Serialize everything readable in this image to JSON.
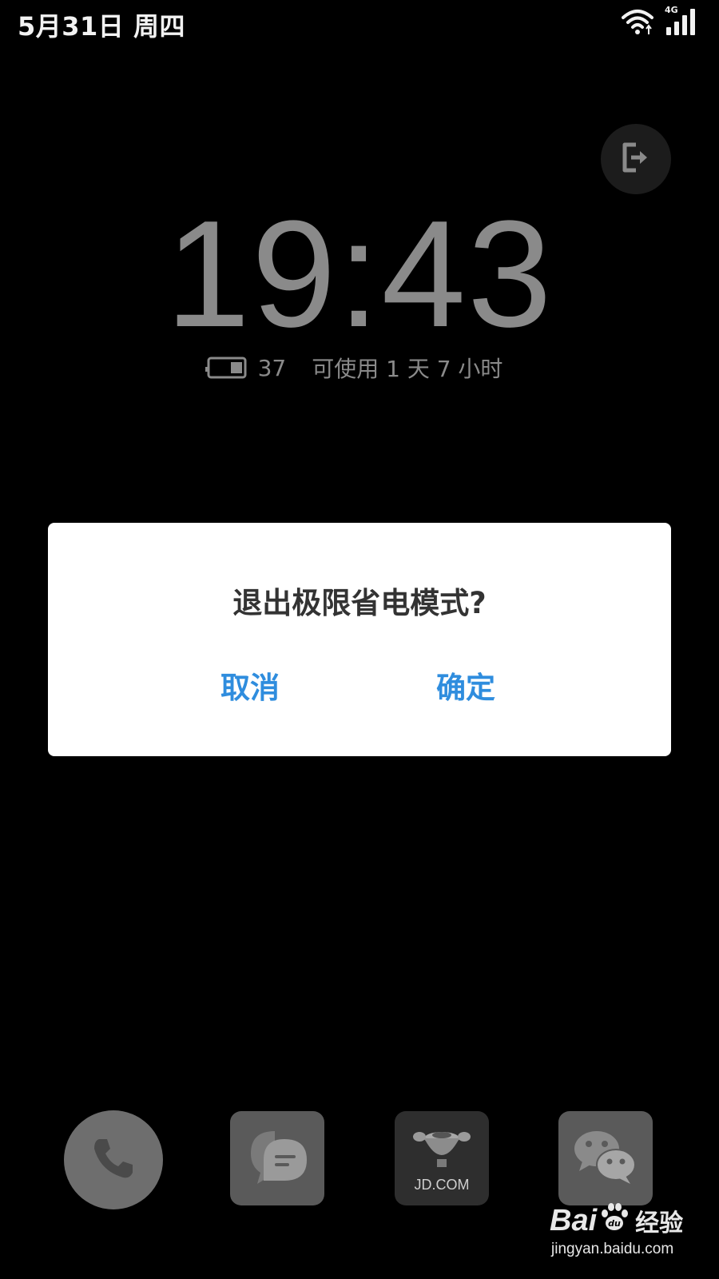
{
  "status_bar": {
    "date": "5月31日 周四",
    "network_type": "4G",
    "icons": [
      "wifi-icon",
      "signal-icon"
    ]
  },
  "exit_button": {
    "icon": "exit-icon"
  },
  "clock": {
    "time": "19:43"
  },
  "battery": {
    "icon": "battery-icon",
    "percent": "37",
    "remaining": "可使用 1 天 7 小时",
    "level": 0.37
  },
  "dialog": {
    "title": "退出极限省电模式?",
    "cancel_label": "取消",
    "confirm_label": "确定",
    "button_color": "#2f8dde"
  },
  "dock": {
    "apps": [
      {
        "icon": "phone-icon"
      },
      {
        "icon": "messages-icon"
      },
      {
        "icon": "jd-icon",
        "label": "JD.COM"
      },
      {
        "icon": "wechat-icon"
      }
    ]
  },
  "watermark": {
    "logo_text_a": "Bai",
    "logo_text_b": "经验",
    "url": "jingyan.baidu.com"
  }
}
